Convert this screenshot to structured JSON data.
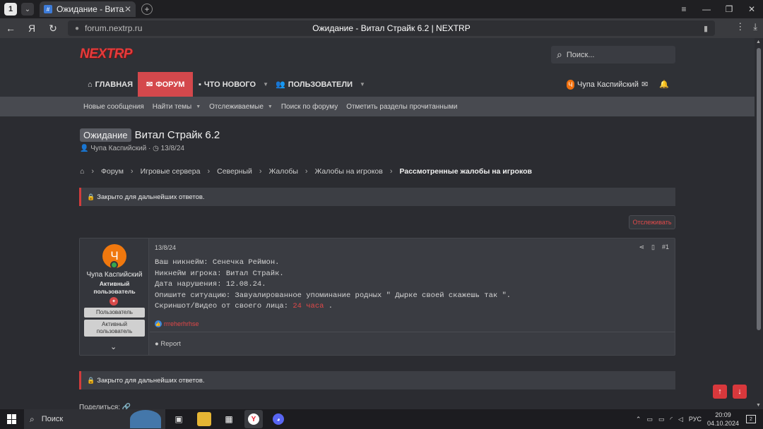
{
  "browser": {
    "tab_count": "1",
    "tab_title": "Ожидание - Витал Страйк 6.2 ",
    "url": "forum.nextrp.ru",
    "page_title": "Ожидание - Витал Страйк 6.2 | NEXTRP"
  },
  "site": {
    "logo": "NEXTRP",
    "search_placeholder": "Поиск..."
  },
  "nav": {
    "home": "ГЛАВНАЯ",
    "forum": "ФОРУМ",
    "whats_new": "ЧТО НОВОГО",
    "members": "ПОЛЬЗОВАТЕЛИ",
    "user_name": "Чупа Каспийский",
    "user_initial": "Ч"
  },
  "subnav": {
    "items": [
      "Новые сообщения",
      "Найти темы",
      "Отслеживаемые",
      "Поиск по форуму",
      "Отметить разделы прочитанными"
    ]
  },
  "thread": {
    "prefix": "Ожидание",
    "title": "Витал Страйк 6.2",
    "author": "Чупа Каспийский",
    "date": "13/8/24"
  },
  "breadcrumb": [
    "Форум",
    "Игровые сервера",
    "Северный",
    "Жалобы",
    "Жалобы на игроков",
    "Рассмотренные жалобы на игроков"
  ],
  "notice": "Закрыто для дальнейших ответов.",
  "follow_button": "Отслеживать",
  "post": {
    "date": "13/8/24",
    "number": "#1",
    "author": "Чупа Каспийский",
    "user_title": "Активный пользователь",
    "banner1": "Пользователь",
    "banner2": "Активный пользователь",
    "line1": "Ваш никнейм: Сенечка Реймон.",
    "line2": "Никнейм игрока: Витал Страйк.",
    "line3": "Дата нарушения: 12.08.24.",
    "line4": "Опишите ситуацию: Завуалированное упоминание родных \" Дырке своей скажешь так \".",
    "line5_prefix": "Скриншот/Видео от своего лица:",
    "line5_highlight": "24 часа",
    "line5_suffix": ".",
    "reaction_user": "rrreherhrhse",
    "report": "Report"
  },
  "share_label": "Поделиться:",
  "taskbar": {
    "search": "Поиск",
    "lang": "РУС",
    "time": "20:09",
    "date": "04.10.2024",
    "notifications": "2"
  },
  "colors": {
    "accent": "#d4484c",
    "avatar": "#f0780e",
    "background": "#2b2c31"
  }
}
